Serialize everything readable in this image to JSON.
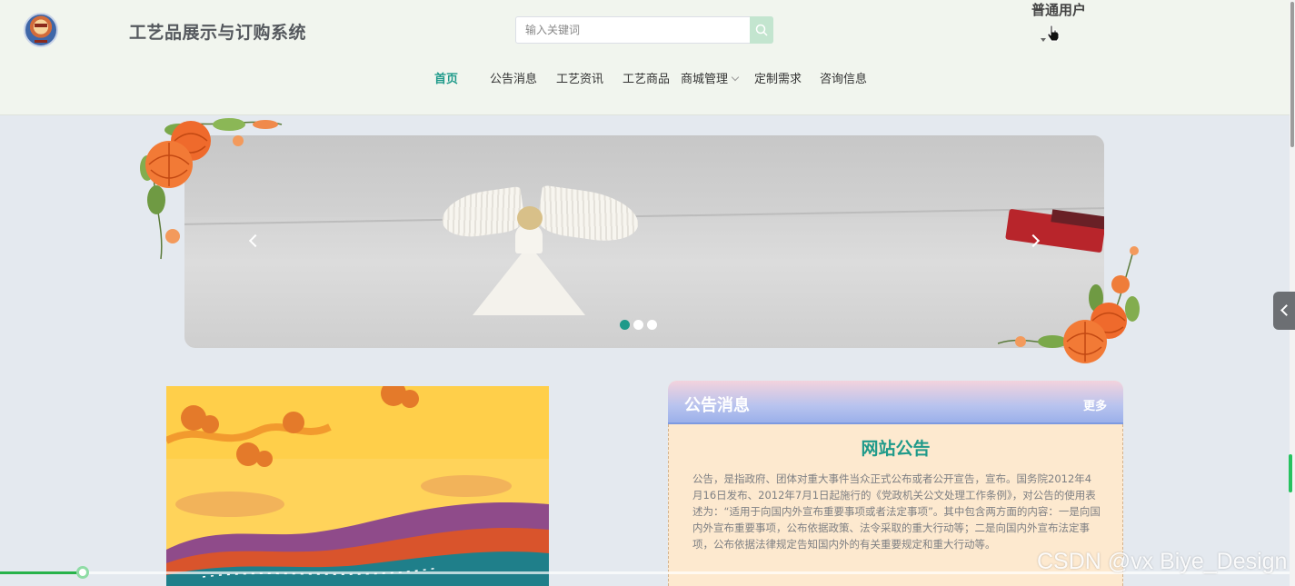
{
  "header": {
    "site_title": "工艺品展示与订购系统",
    "search": {
      "placeholder": "输入关键词",
      "value": ""
    },
    "user_label": "普通用户"
  },
  "nav": {
    "items": [
      {
        "label": "首页",
        "active": true
      },
      {
        "label": "公告消息"
      },
      {
        "label": "工艺资讯"
      },
      {
        "label": "工艺商品"
      },
      {
        "label": "商城管理",
        "has_dropdown": true
      },
      {
        "label": "定制需求"
      },
      {
        "label": "咨询信息"
      }
    ]
  },
  "carousel": {
    "slide_count": 3,
    "active_index": 0
  },
  "notice": {
    "title": "公告消息",
    "more": "更多",
    "subtitle": "网站公告",
    "text": "公告，是指政府、团体对重大事件当众正式公布或者公开宣告，宣布。国务院2012年4月16日发布、2012年7月1日起施行的《党政机关公文处理工作条例》，对公告的使用表述为：“适用于向国内外宣布重要事项或者法定事项”。其中包含两方面的内容：一是向国内外宣布重要事项，公布依据政策、法令采取的重大行动等；二是向国内外宣布法定事项，公布依据法律规定告知国内外的有关重要规定和重大行动等。"
  },
  "watermark": "CSDN @vx Biye_Design",
  "colors": {
    "accent": "#1f9a8a",
    "header_bg": "#f1f5ee",
    "page_bg": "#e4e9ef",
    "notice_bg": "#fde9cf"
  },
  "icons": [
    "logo-icon",
    "search-icon",
    "pointer-cursor-icon",
    "chevron-down-icon",
    "chevron-left-icon",
    "chevron-right-icon"
  ]
}
